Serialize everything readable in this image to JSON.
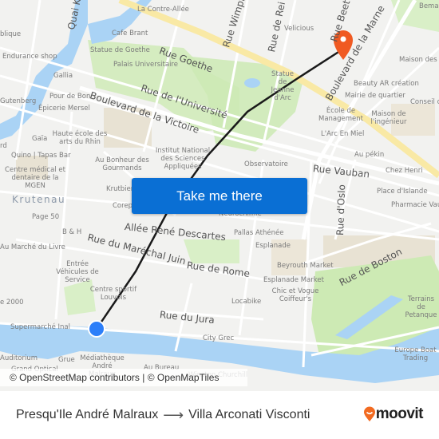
{
  "map": {
    "colors": {
      "land": "#f2f2f0",
      "water": "#aad3f5",
      "park": "#cdeab4",
      "major_road": "#f9e9a5",
      "building": "#e8e2d3",
      "route_line": "#1a1a1a",
      "origin_marker": "#2d7ff9",
      "destination_marker": "#f05a22"
    },
    "streets": [
      "Quai K",
      "Rue Goethe",
      "Rue Wimpf",
      "Rue de Rei",
      "Rue Beet",
      "Rue de l'Université",
      "Boulevard de la Victoire",
      "Boulevard de la Marne",
      "Rue Vauban",
      "Rue d'Oslo",
      "Allée René Descartes",
      "Rue du Maréchal Juin",
      "Rue de Rome",
      "Rue de Boston",
      "Rue du Jura"
    ],
    "district": "Krutenau",
    "pois": [
      "La Contre-Allée",
      "Cafe Brant",
      "Statue de Goethe",
      "Palais Universitaire",
      "Velicious",
      "Statue de Jeanne d'Arc",
      "blique",
      "Endurance shop",
      "Gallia",
      "Pour de Bon",
      "Épicerie Mersel",
      "Gutenberg",
      "Bema",
      "Maison des A",
      "Beauty AR création",
      "Mairie de quartier",
      "Conseil c",
      "École de Management",
      "Maison de l'ingénieur",
      "L'Arc En Miel",
      "Au pékin",
      "Chez Henri",
      "Place d'Islande",
      "Pharmacie Vau",
      "Haute école des arts du Rhin",
      "Gaïa",
      "rd",
      "Quino | Tapas Bar",
      "Centre médical et dentaire de la MGEN",
      "Au Bonheur des Gourmands",
      "Institut National des Sciences Appliquées",
      "Observatoire",
      "Krutbien",
      "Corep",
      "Page 50",
      "Neurochimie",
      "B & H",
      "Pallas Athénée",
      "Esplanade",
      "Au Marché du Livre",
      "Entrée Véhicules de Service",
      "Beyrouth Market",
      "Esplanade Market",
      "Chic et Vogue Coiffeur's",
      "Centre sportif Louvois",
      "Locabike",
      "e 2000",
      "Terrains de Petanque",
      "Supermarché Inal",
      "City Grec",
      "Europe Boat Trading",
      "Auditorium",
      "Grue",
      "Médiathèque André Malraux",
      "Au Bureau",
      "Grand Optical",
      "Winston Churchill"
    ]
  },
  "cta": {
    "label": "Take me there"
  },
  "attribution": "© OpenStreetMap contributors | © OpenMapTiles",
  "footer": {
    "from": "Presqu'Ile André Malraux",
    "arrow": "⟶",
    "to": "Villa Arconati Visconti",
    "brand": "moovit",
    "brand_color": "#f26b21"
  }
}
